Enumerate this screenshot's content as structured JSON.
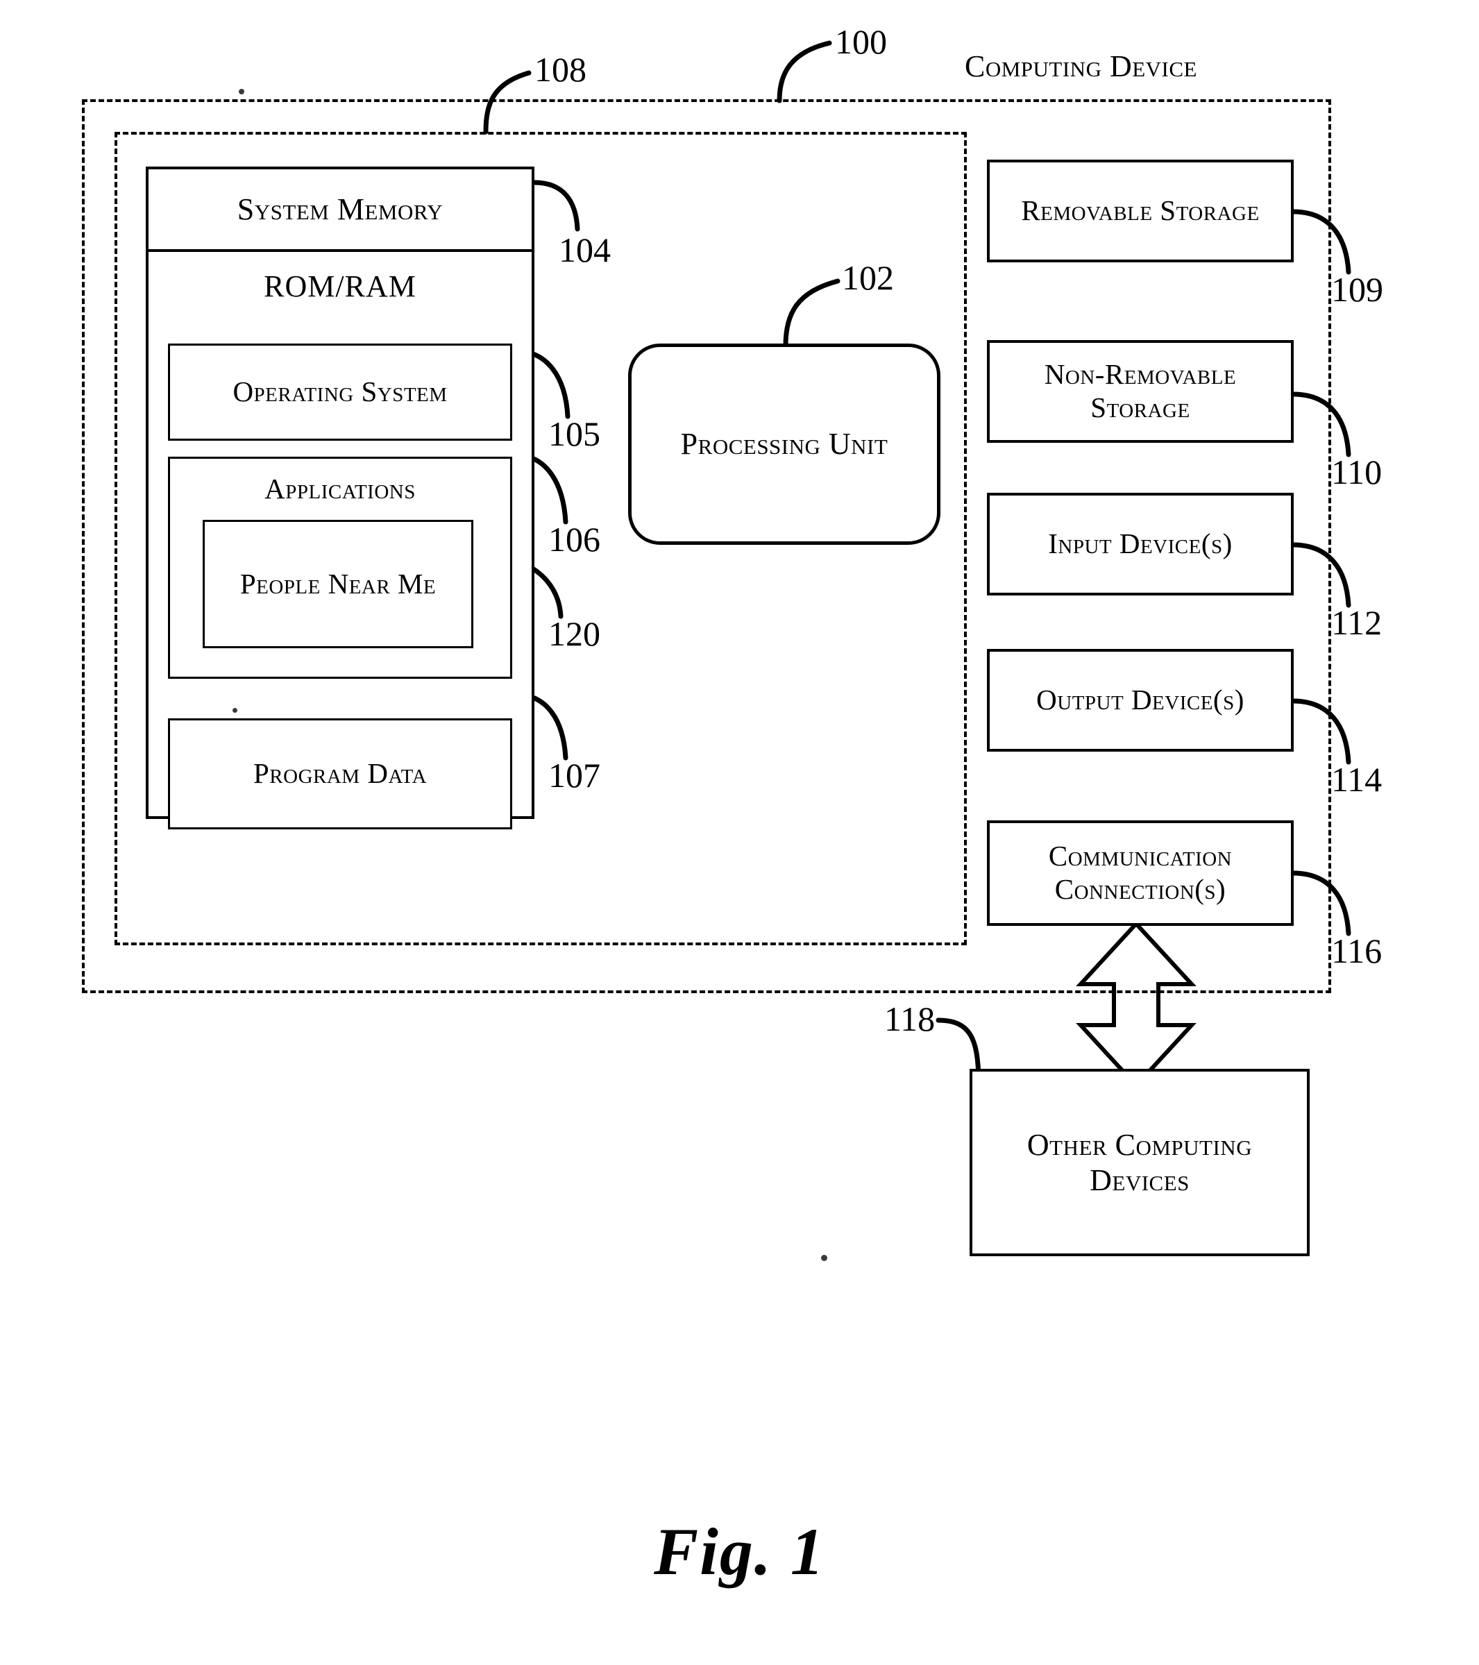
{
  "figure": {
    "caption": "Fig. 1",
    "diagram_title": "Computing Device"
  },
  "reference_numerals": {
    "computing_device": "100",
    "processing_unit": "102",
    "system_memory": "104",
    "operating_system": "105",
    "applications": "106",
    "program_data": "107",
    "memory_region": "108",
    "removable_storage": "109",
    "non_removable_storage": "110",
    "input_devices": "112",
    "output_devices": "114",
    "communication_connections": "116",
    "other_computing_devices": "118",
    "people_near_me": "120"
  },
  "blocks": {
    "system_memory": "System Memory",
    "rom_ram": "ROM/RAM",
    "operating_system": "Operating System",
    "applications": "Applications",
    "people_near_me": "People Near Me",
    "program_data": "Program Data",
    "processing_unit": "Processing Unit",
    "removable_storage": "Removable Storage",
    "non_removable_storage": "Non-Removable Storage",
    "input_devices": "Input Device(s)",
    "output_devices": "Output Device(s)",
    "communication_connections": "Communication Connection(s)",
    "other_computing_devices": "Other Computing Devices"
  },
  "chart_data": {
    "type": "diagram",
    "title": "Computing Device",
    "nodes": [
      {
        "id": "100",
        "label": "Computing Device",
        "shape": "dashed-rect",
        "role": "outer-boundary"
      },
      {
        "id": "108",
        "label": "",
        "shape": "dashed-rect",
        "role": "inner-boundary"
      },
      {
        "id": "104",
        "label": "System Memory",
        "shape": "rect"
      },
      {
        "id": "104b",
        "label": "ROM/RAM",
        "shape": "rect"
      },
      {
        "id": "105",
        "label": "Operating System",
        "shape": "rect"
      },
      {
        "id": "106",
        "label": "Applications",
        "shape": "rect"
      },
      {
        "id": "120",
        "label": "People Near Me",
        "shape": "rect"
      },
      {
        "id": "107",
        "label": "Program Data",
        "shape": "rect"
      },
      {
        "id": "102",
        "label": "Processing Unit",
        "shape": "rounded-rect"
      },
      {
        "id": "109",
        "label": "Removable Storage",
        "shape": "rect"
      },
      {
        "id": "110",
        "label": "Non-Removable Storage",
        "shape": "rect"
      },
      {
        "id": "112",
        "label": "Input Device(s)",
        "shape": "rect"
      },
      {
        "id": "114",
        "label": "Output Device(s)",
        "shape": "rect"
      },
      {
        "id": "116",
        "label": "Communication Connection(s)",
        "shape": "rect"
      },
      {
        "id": "118",
        "label": "Other Computing Devices",
        "shape": "rect"
      }
    ],
    "edges": [
      {
        "from": "116",
        "to": "118",
        "style": "double-headed-block-arrow",
        "direction": "bidirectional"
      }
    ],
    "containment": [
      {
        "parent": "100",
        "children": [
          "108",
          "109",
          "110",
          "112",
          "114",
          "116"
        ]
      },
      {
        "parent": "108",
        "children": [
          "104",
          "102"
        ]
      },
      {
        "parent": "104",
        "children": [
          "104b"
        ]
      },
      {
        "parent": "104b",
        "children": [
          "105",
          "106",
          "107"
        ]
      },
      {
        "parent": "106",
        "children": [
          "120"
        ]
      }
    ]
  }
}
